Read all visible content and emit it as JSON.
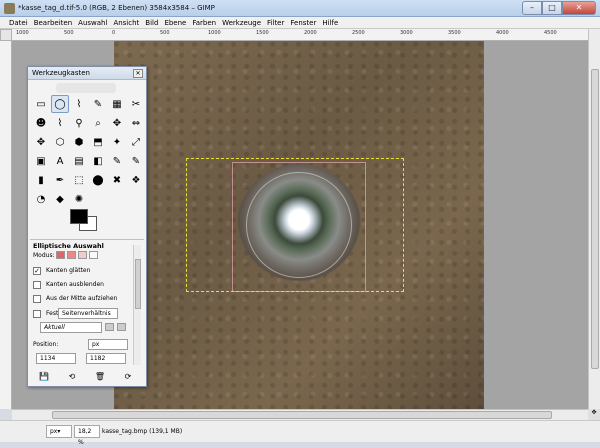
{
  "window": {
    "title": "*kasse_tag_d.tif-5.0 (RGB, 2 Ebenen) 3584x3584 – GIMP"
  },
  "wincontrols": {
    "minimize": "–",
    "maximize": "□",
    "close": "✕"
  },
  "menu": [
    "Datei",
    "Bearbeiten",
    "Auswahl",
    "Ansicht",
    "Bild",
    "Ebene",
    "Farben",
    "Werkzeuge",
    "Filter",
    "Fenster",
    "Hilfe"
  ],
  "ruler": {
    "ticks": [
      "1000",
      "500",
      "0",
      "500",
      "1000",
      "1500",
      "2000",
      "2500",
      "3000",
      "3500",
      "4000",
      "4500"
    ]
  },
  "toolbox": {
    "title": "Werkzeugkasten",
    "close": "✕",
    "tools": [
      "▭",
      "◯",
      "⌇",
      "✎",
      "▦",
      "✂",
      "☻",
      "⌇",
      "⚲",
      "⌕",
      "✥",
      "⇔",
      "✥",
      "⬡",
      "⬢",
      "⬒",
      "✦",
      "⤢",
      "▣",
      "A",
      "▤",
      "◧",
      "✎",
      "✎",
      "▮",
      "✒",
      "⬚",
      "⬤",
      "✖",
      "❖",
      "◔",
      "◆",
      "✺",
      "",
      "",
      ""
    ],
    "options_title": "Elliptische Auswahl",
    "modus_label": "Modus:",
    "kanten_glaetten": "Kanten glätten",
    "kanten_ausblenden": "Kanten ausblenden",
    "aus_der_mitte": "Aus der Mitte aufziehen",
    "fest_label": "Fest:",
    "fest_value": "Seitenverhältnis",
    "aktuell": "Aktuell",
    "position_label": "Position:",
    "position_unit": "px",
    "position_x": "1134",
    "position_y": "1182",
    "bottom_icons": [
      "💾",
      "⟲",
      "🗑",
      "⟳"
    ],
    "kanten_glaetten_checked": true
  },
  "status": {
    "unit": "px▾",
    "zoom": "18,2 %",
    "file": "kasse_tag.bmp (139,1 MB)"
  },
  "colors": {
    "selection": "#e8e230",
    "canvas_bg": "#a4a4a4"
  }
}
